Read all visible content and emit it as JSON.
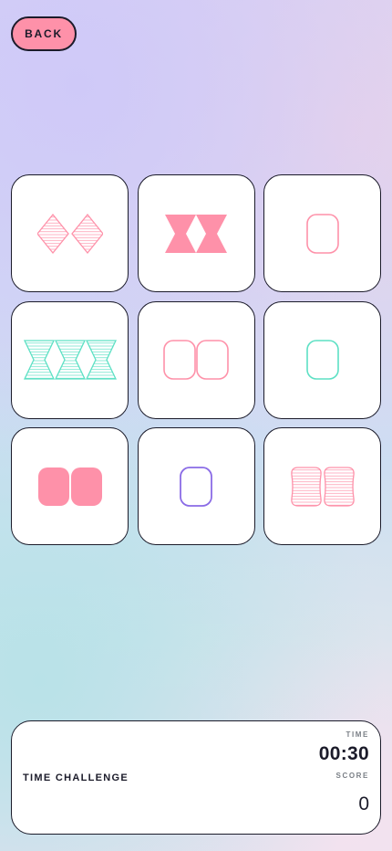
{
  "header": {
    "back_label": "BACK"
  },
  "colors": {
    "pink": "#fe91a9",
    "teal": "#5de0c4",
    "purple": "#8a6be6",
    "outline": "#1b1b2a"
  },
  "cards": [
    {
      "shape": "diamond",
      "count": 2,
      "fill": "striped",
      "color": "pink"
    },
    {
      "shape": "hourglass",
      "count": 2,
      "fill": "solid",
      "color": "pink"
    },
    {
      "shape": "rounded-rect",
      "count": 1,
      "fill": "empty",
      "color": "pink"
    },
    {
      "shape": "hourglass",
      "count": 3,
      "fill": "striped",
      "color": "teal"
    },
    {
      "shape": "rounded-rect",
      "count": 2,
      "fill": "empty",
      "color": "pink"
    },
    {
      "shape": "rounded-rect",
      "count": 1,
      "fill": "empty",
      "color": "teal"
    },
    {
      "shape": "rounded-rect",
      "count": 2,
      "fill": "solid",
      "color": "pink"
    },
    {
      "shape": "rounded-rect",
      "count": 1,
      "fill": "empty",
      "color": "purple"
    },
    {
      "shape": "barrel",
      "count": 2,
      "fill": "striped",
      "color": "pink"
    }
  ],
  "panel": {
    "mode_label": "TIME CHALLENGE",
    "time_label": "TIME",
    "time_value": "00:30",
    "score_label": "SCORE",
    "score_value": "0"
  }
}
